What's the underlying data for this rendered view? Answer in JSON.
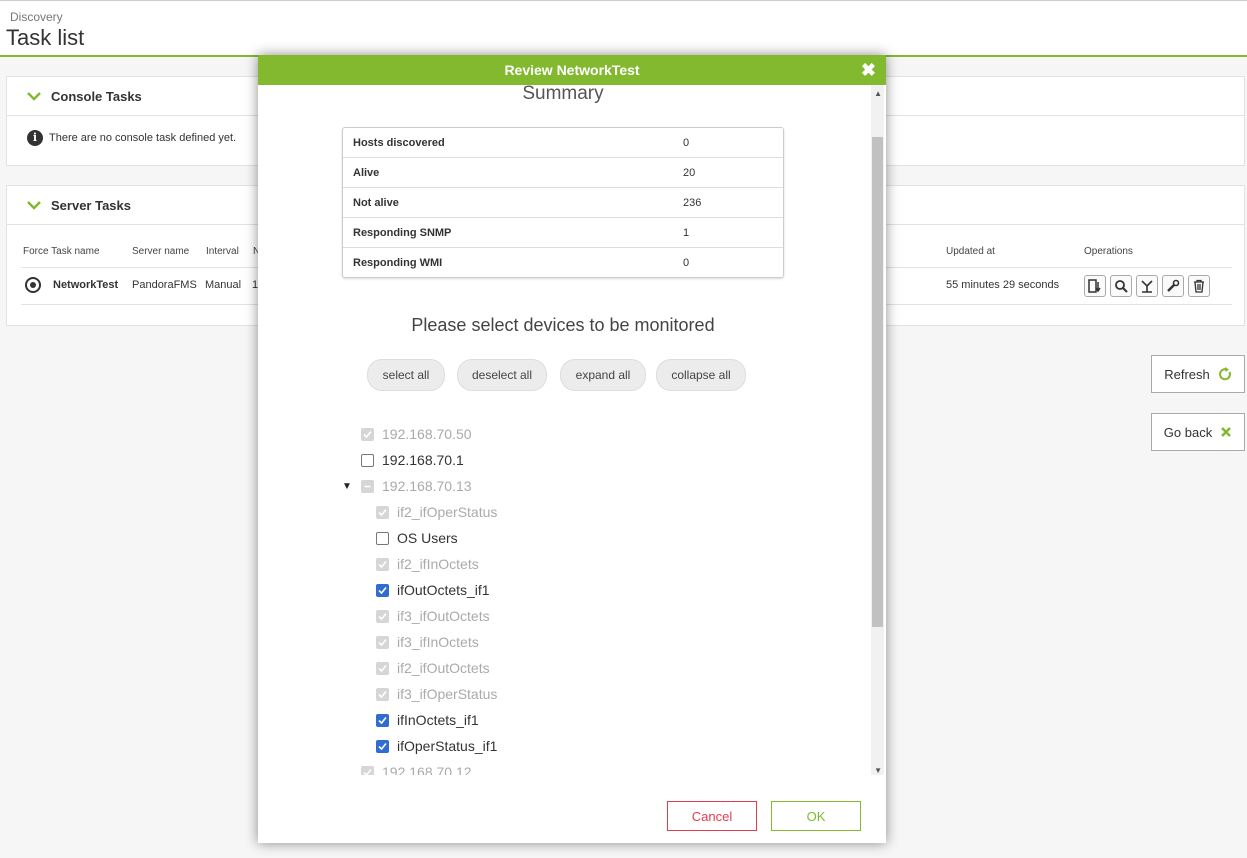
{
  "header": {
    "breadcrumb": "Discovery",
    "title": "Task list"
  },
  "console_tasks": {
    "title": "Console Tasks",
    "message": "There are no console task defined yet."
  },
  "server_tasks": {
    "title": "Server Tasks",
    "columns": [
      "Force Task name",
      "Server name",
      "Interval",
      "N",
      "Updated at",
      "Operations"
    ],
    "row": {
      "name": "NetworkTest",
      "server": "PandoraFMS",
      "interval": "Manual",
      "n": "1",
      "updated": "55 minutes 29 seconds"
    }
  },
  "side_buttons": {
    "refresh": "Refresh",
    "go_back": "Go back"
  },
  "modal": {
    "title": "Review NetworkTest",
    "summary_title": "Summary",
    "summary_rows": [
      {
        "label": "Hosts discovered",
        "value": "0"
      },
      {
        "label": "Alive",
        "value": "20"
      },
      {
        "label": "Not alive",
        "value": "236"
      },
      {
        "label": "Responding SNMP",
        "value": "1"
      },
      {
        "label": "Responding WMI",
        "value": "0"
      }
    ],
    "select_title": "Please select devices to be monitored",
    "buttons": {
      "select_all": "select all",
      "deselect_all": "deselect all",
      "expand_all": "expand all",
      "collapse_all": "collapse all"
    },
    "tree": [
      {
        "label": "192.168.70.50",
        "state": "disabled"
      },
      {
        "label": "192.168.70.1",
        "state": "unchecked"
      },
      {
        "label": "192.168.70.13",
        "state": "partial"
      },
      {
        "label": "if2_ifOperStatus",
        "state": "disabled"
      },
      {
        "label": "OS Users",
        "state": "unchecked"
      },
      {
        "label": "if2_ifInOctets",
        "state": "disabled"
      },
      {
        "label": "ifOutOctets_if1",
        "state": "checked"
      },
      {
        "label": "if3_ifOutOctets",
        "state": "disabled"
      },
      {
        "label": "if3_ifInOctets",
        "state": "disabled"
      },
      {
        "label": "if2_ifOutOctets",
        "state": "disabled"
      },
      {
        "label": "if3_ifOperStatus",
        "state": "disabled"
      },
      {
        "label": "ifInOctets_if1",
        "state": "checked"
      },
      {
        "label": "ifOperStatus_if1",
        "state": "checked"
      },
      {
        "label": "192.168.70.12",
        "state": "disabled"
      }
    ],
    "cancel": "Cancel",
    "ok": "OK"
  },
  "colors": {
    "accent": "#82b92e",
    "danger": "#e63c52",
    "check": "#2f6dd0"
  }
}
